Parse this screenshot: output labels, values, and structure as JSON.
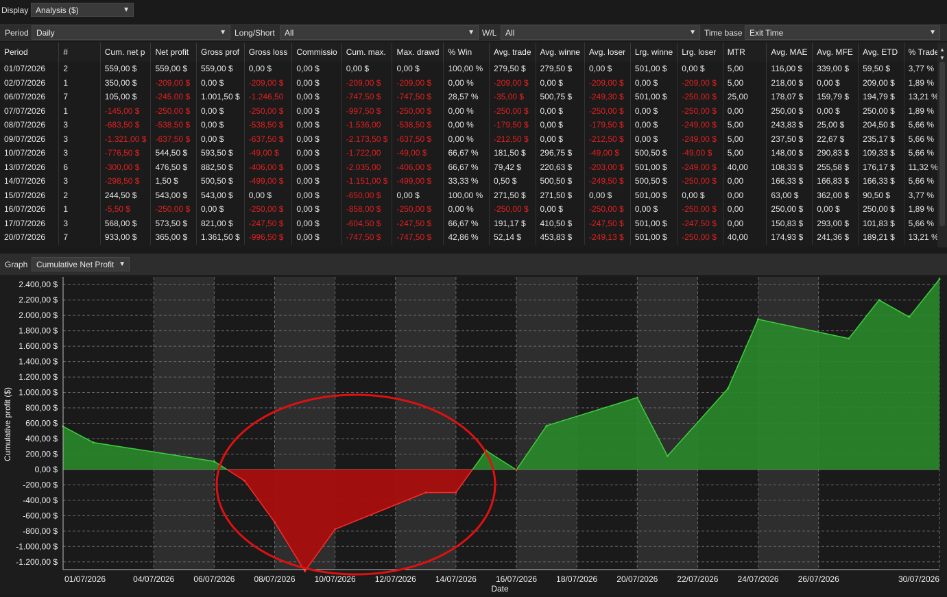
{
  "display": {
    "label": "Display",
    "value": "Analysis ($)"
  },
  "filters": {
    "period": {
      "label": "Period",
      "value": "Daily"
    },
    "long_short": {
      "label": "Long/Short",
      "value": "All"
    },
    "wl": {
      "label": "W/L",
      "value": "All"
    },
    "time_base": {
      "label": "Time base",
      "value": "Exit Time"
    }
  },
  "table": {
    "columns": [
      "Period",
      "#",
      "Cum. net p",
      "Net profit",
      "Gross prof",
      "Gross loss",
      "Commissio",
      "Cum. max.",
      "Max. drawd",
      "% Win",
      "Avg. trade",
      "Avg. winne",
      "Avg. loser",
      "Lrg. winne",
      "Lrg. loser",
      "MTR",
      "Avg. MAE",
      "Avg. MFE",
      "Avg. ETD",
      "% Trade"
    ],
    "rows": [
      [
        "01/07/2026",
        "2",
        "559,00 $",
        "559,00 $",
        "559,00 $",
        "0,00 $",
        "0,00 $",
        "0,00 $",
        "0,00 $",
        "100,00 %",
        "279,50 $",
        "279,50 $",
        "0,00 $",
        "501,00 $",
        "0,00 $",
        "5,00",
        "116,00 $",
        "339,00 $",
        "59,50 $",
        "3,77 %"
      ],
      [
        "02/07/2026",
        "1",
        "350,00 $",
        "-209,00 $",
        "0,00 $",
        "-209,00 $",
        "0,00 $",
        "-209,00 $",
        "-209,00 $",
        "0,00 %",
        "-209,00 $",
        "0,00 $",
        "-209,00 $",
        "0,00 $",
        "-209,00 $",
        "5,00",
        "218,00 $",
        "0,00 $",
        "209,00 $",
        "1,89 %"
      ],
      [
        "06/07/2026",
        "7",
        "105,00 $",
        "-245,00 $",
        "1.001,50 $",
        "-1.246,50",
        "0,00 $",
        "-747,50 $",
        "-747,50 $",
        "28,57 %",
        "-35,00 $",
        "500,75 $",
        "-249,30 $",
        "501,00 $",
        "-250,00 $",
        "25,00",
        "178,07 $",
        "159,79 $",
        "194,79 $",
        "13,21 %"
      ],
      [
        "07/07/2026",
        "1",
        "-145,00 $",
        "-250,00 $",
        "0,00 $",
        "-250,00 $",
        "0,00 $",
        "-997,50 $",
        "-250,00 $",
        "0,00 %",
        "-250,00 $",
        "0,00 $",
        "-250,00 $",
        "0,00 $",
        "-250,00 $",
        "0,00",
        "250,00 $",
        "0,00 $",
        "250,00 $",
        "1,89 %"
      ],
      [
        "08/07/2026",
        "3",
        "-683,50 $",
        "-538,50 $",
        "0,00 $",
        "-538,50 $",
        "0,00 $",
        "-1.536,00",
        "-538,50 $",
        "0,00 %",
        "-179,50 $",
        "0,00 $",
        "-179,50 $",
        "0,00 $",
        "-249,00 $",
        "5,00",
        "243,83 $",
        "25,00 $",
        "204,50 $",
        "5,66 %"
      ],
      [
        "09/07/2026",
        "3",
        "-1.321,00 $",
        "-637,50 $",
        "0,00 $",
        "-637,50 $",
        "0,00 $",
        "-2.173,50 $",
        "-637,50 $",
        "0,00 %",
        "-212,50 $",
        "0,00 $",
        "-212,50 $",
        "0,00 $",
        "-249,00 $",
        "5,00",
        "237,50 $",
        "22,67 $",
        "235,17 $",
        "5,66 %"
      ],
      [
        "10/07/2026",
        "3",
        "-776,50 $",
        "544,50 $",
        "593,50 $",
        "-49,00 $",
        "0,00 $",
        "-1.722,00",
        "-49,00 $",
        "66,67 %",
        "181,50 $",
        "296,75 $",
        "-49,00 $",
        "500,50 $",
        "-49,00 $",
        "5,00",
        "148,00 $",
        "290,83 $",
        "109,33 $",
        "5,66 %"
      ],
      [
        "13/07/2026",
        "6",
        "-300,00 $",
        "476,50 $",
        "882,50 $",
        "-406,00 $",
        "0,00 $",
        "-2.035,00",
        "-406,00 $",
        "66,67 %",
        "79,42 $",
        "220,63 $",
        "-203,00 $",
        "501,00 $",
        "-249,00 $",
        "40,00",
        "108,33 $",
        "255,58 $",
        "176,17 $",
        "11,32 %"
      ],
      [
        "14/07/2026",
        "3",
        "-298,50 $",
        "1,50 $",
        "500,50 $",
        "-499,00 $",
        "0,00 $",
        "-1.151,00 $",
        "-499,00 $",
        "33,33 %",
        "0,50 $",
        "500,50 $",
        "-249,50 $",
        "500,50 $",
        "-250,00 $",
        "0,00",
        "166,33 $",
        "166,83 $",
        "166,33 $",
        "5,66 %"
      ],
      [
        "15/07/2026",
        "2",
        "244,50 $",
        "543,00 $",
        "543,00 $",
        "0,00 $",
        "0,00 $",
        "-650,00 $",
        "0,00 $",
        "100,00 %",
        "271,50 $",
        "271,50 $",
        "0,00 $",
        "501,00 $",
        "0,00 $",
        "0,00",
        "63,00 $",
        "362,00 $",
        "90,50 $",
        "3,77 %"
      ],
      [
        "16/07/2026",
        "1",
        "-5,50 $",
        "-250,00 $",
        "0,00 $",
        "-250,00 $",
        "0,00 $",
        "-858,00 $",
        "-250,00 $",
        "0,00 %",
        "-250,00 $",
        "0,00 $",
        "-250,00 $",
        "0,00 $",
        "-250,00 $",
        "0,00",
        "250,00 $",
        "0,00 $",
        "250,00 $",
        "1,89 %"
      ],
      [
        "17/07/2026",
        "3",
        "568,00 $",
        "573,50 $",
        "821,00 $",
        "-247,50 $",
        "0,00 $",
        "-604,50 $",
        "-247,50 $",
        "66,67 %",
        "191,17 $",
        "410,50 $",
        "-247,50 $",
        "501,00 $",
        "-247,50 $",
        "0,00",
        "150,83 $",
        "293,00 $",
        "101,83 $",
        "5,66 %"
      ],
      [
        "20/07/2026",
        "7",
        "933,00 $",
        "365,00 $",
        "1.361,50 $",
        "-996,50 $",
        "0,00 $",
        "-747,50 $",
        "-747,50 $",
        "42,86 %",
        "52,14 $",
        "453,83 $",
        "-249,13 $",
        "501,00 $",
        "-250,00 $",
        "40,00",
        "174,93 $",
        "241,36 $",
        "189,21 $",
        "13,21 %"
      ]
    ]
  },
  "graph": {
    "label": "Graph",
    "value": "Cumulative Net Profit"
  },
  "chart_data": {
    "type": "area",
    "xlabel": "Date",
    "ylabel": "Cumulative profit ($)",
    "ylim": [
      -1300,
      2500
    ],
    "yticks": [
      -1200,
      -1000,
      -800,
      -600,
      -400,
      -200,
      0,
      200,
      400,
      600,
      800,
      1000,
      1200,
      1400,
      1600,
      1800,
      2000,
      2200,
      2400
    ],
    "ytick_labels": [
      "-1.200,00 $",
      "-1.000,00 $",
      "-800,00 $",
      "-600,00 $",
      "-400,00 $",
      "-200,00 $",
      "0,00 $",
      "200,00 $",
      "400,00 $",
      "600,00 $",
      "800,00 $",
      "1.000,00 $",
      "1.200,00 $",
      "1.400,00 $",
      "1.600,00 $",
      "1.800,00 $",
      "2.000,00 $",
      "2.200,00 $",
      "2.400,00 $"
    ],
    "xtick_labels": [
      "01/07/2026",
      "04/07/2026",
      "06/07/2026",
      "08/07/2026",
      "10/07/2026",
      "12/07/2026",
      "14/07/2026",
      "16/07/2026",
      "18/07/2026",
      "20/07/2026",
      "22/07/2026",
      "24/07/2026",
      "26/07/2026",
      "30/07/2026"
    ],
    "x": [
      "01/07/2026",
      "02/07/2026",
      "06/07/2026",
      "07/07/2026",
      "08/07/2026",
      "09/07/2026",
      "10/07/2026",
      "13/07/2026",
      "14/07/2026",
      "15/07/2026",
      "16/07/2026",
      "17/07/2026",
      "20/07/2026",
      "21/07/2026",
      "23/07/2026",
      "24/07/2026",
      "27/07/2026",
      "28/07/2026",
      "29/07/2026",
      "30/07/2026"
    ],
    "values": [
      559,
      350,
      105,
      -145,
      -683.5,
      -1321,
      -776.5,
      -300,
      -298.5,
      244.5,
      -5.5,
      568,
      933,
      175,
      1050,
      1950,
      1700,
      2200,
      1980,
      2470
    ],
    "positive_color": "#2e9e2e",
    "negative_color": "#d01010",
    "annotation": "red-ellipse-around-drawdown"
  },
  "colors": {
    "negative_text": "#e02020",
    "positive_fill": "#2e9e2e",
    "negative_fill": "#c01010",
    "highlight": "#e01010"
  }
}
